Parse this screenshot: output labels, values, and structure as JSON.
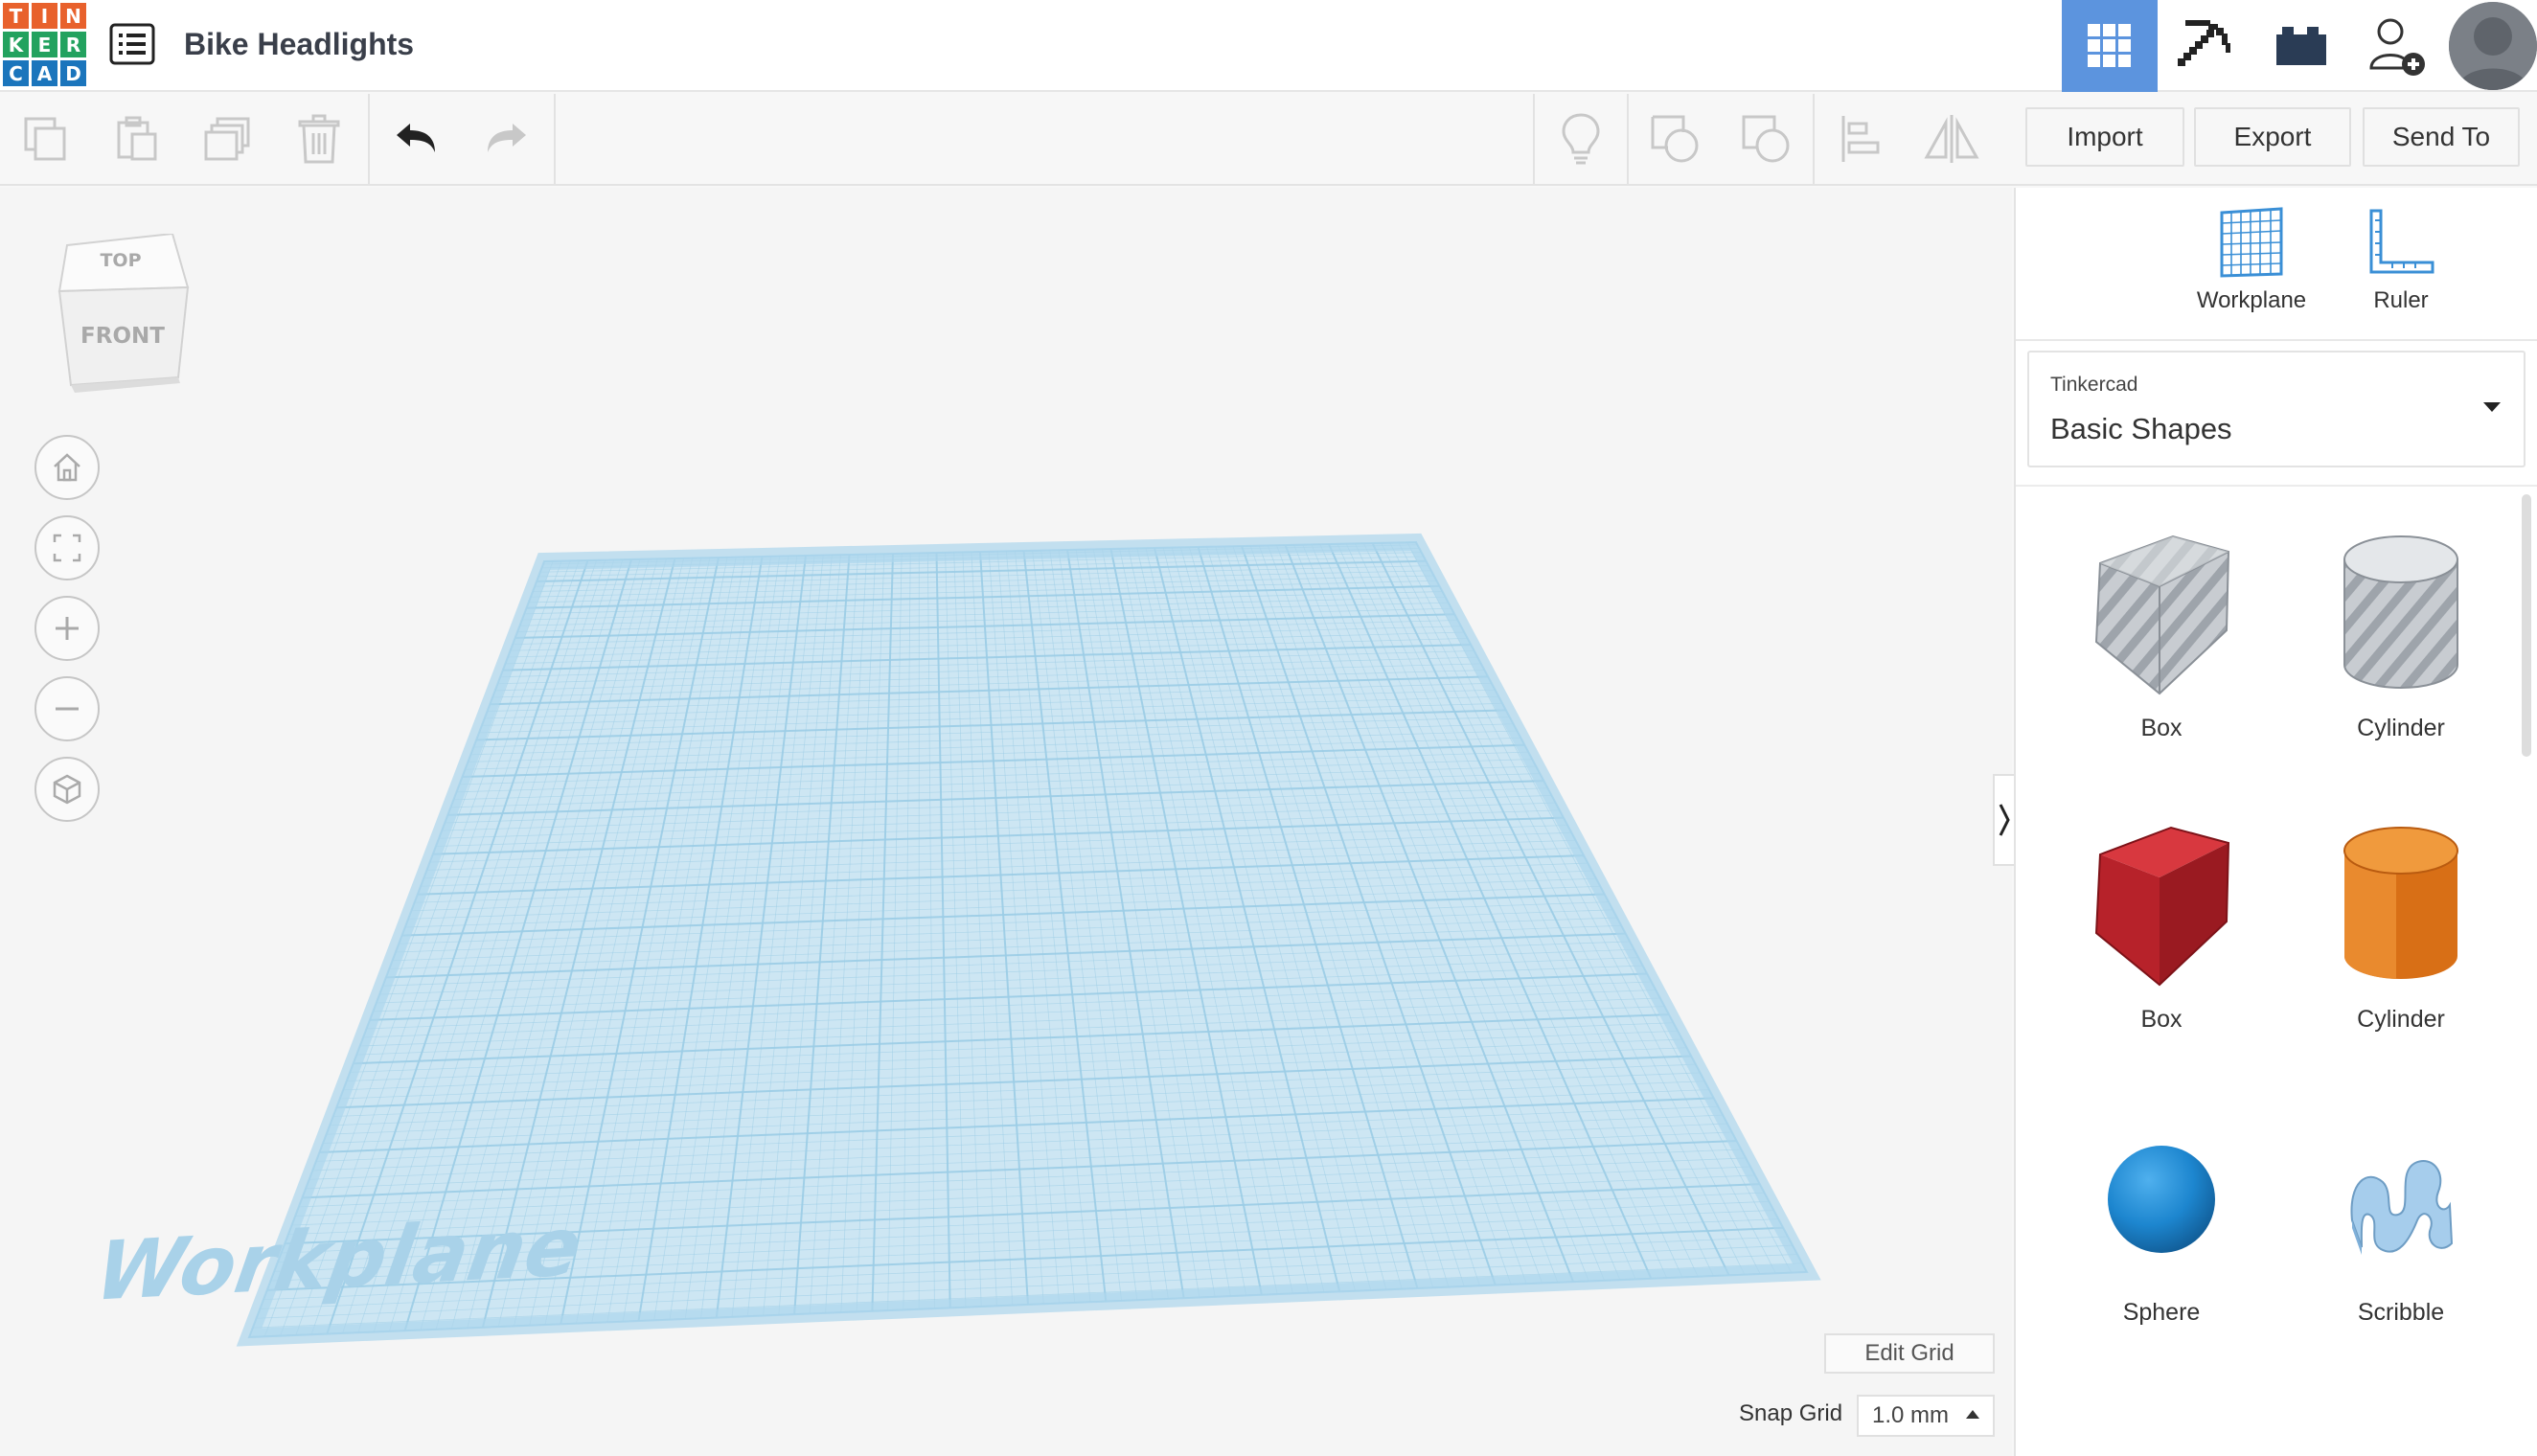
{
  "app": {
    "logo_letters": [
      "T",
      "I",
      "N",
      "K",
      "E",
      "R",
      "C",
      "A",
      "D"
    ],
    "logo_colors": [
      "#e8612c",
      "#e8612c",
      "#e8612c",
      "#23a25f",
      "#23a25f",
      "#23a25f",
      "#1b75bc",
      "#1b75bc",
      "#1b75bc"
    ],
    "design_title": "Bike Headlights",
    "accent_color": "#5c94de"
  },
  "topbar": {
    "buttons": [
      {
        "name": "3d-design-view-icon",
        "active": true
      },
      {
        "name": "pickaxe-icon",
        "active": false
      },
      {
        "name": "bricks-icon",
        "active": false
      },
      {
        "name": "add-user-icon",
        "active": false
      }
    ]
  },
  "toolbar": {
    "left_icons": [
      "copy-icon",
      "paste-icon",
      "duplicate-icon",
      "delete-icon",
      "undo-icon",
      "redo-icon"
    ],
    "right_icons": [
      "lightbulb-icon",
      "solid-shape-icon",
      "hole-shape-icon",
      "align-icon",
      "mirror-icon"
    ],
    "import_label": "Import",
    "export_label": "Export",
    "send_to_label": "Send To"
  },
  "viewcube": {
    "top_label": "TOP",
    "front_label": "FRONT"
  },
  "nav_controls": [
    "home-view-icon",
    "fit-view-icon",
    "zoom-in-icon",
    "zoom-out-icon",
    "perspective-icon"
  ],
  "workplane": {
    "watermark": "Workplane",
    "grid_color": "#9ccde6"
  },
  "grid_controls": {
    "edit_grid_label": "Edit Grid",
    "snap_grid_label": "Snap Grid",
    "snap_grid_value": "1.0 mm"
  },
  "panel": {
    "tools": [
      {
        "label": "Workplane",
        "icon": "workplane-grid-icon"
      },
      {
        "label": "Ruler",
        "icon": "ruler-icon"
      }
    ],
    "library_category": "Tinkercad",
    "library_name": "Basic Shapes",
    "shapes": [
      {
        "label": "Box",
        "kind": "box-hole",
        "color": "#b8bcc2"
      },
      {
        "label": "Cylinder",
        "kind": "cylinder-hole",
        "color": "#b8bcc2"
      },
      {
        "label": "Box",
        "kind": "box",
        "color": "#c4222a"
      },
      {
        "label": "Cylinder",
        "kind": "cylinder",
        "color": "#e37b1f"
      },
      {
        "label": "Sphere",
        "kind": "sphere",
        "color": "#1e8cd6"
      },
      {
        "label": "Scribble",
        "kind": "scribble",
        "color": "#9ec8e8"
      }
    ]
  }
}
